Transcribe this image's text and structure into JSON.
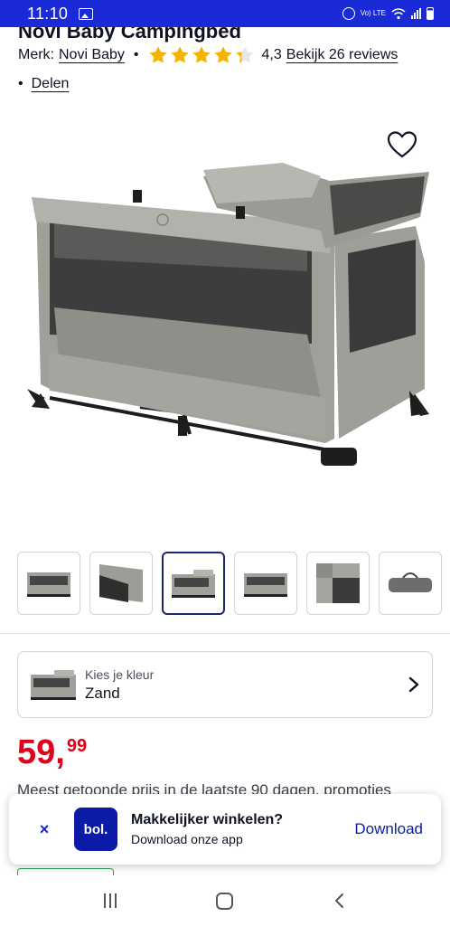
{
  "status_bar": {
    "time": "11:10",
    "network_label": "Vo) LTE",
    "icons": [
      "gallery-icon",
      "alarm-icon",
      "wifi-icon",
      "signal-icon",
      "battery-icon"
    ]
  },
  "product": {
    "title_cropped": "Novi Baby Campingbed",
    "brand_label": "Merk:",
    "brand_name": "Novi Baby",
    "rating": 4.3,
    "rating_text": "4,3",
    "rating_max": 5,
    "reviews_link": "Bekijk 26 reviews",
    "share_link": "Delen"
  },
  "gallery": {
    "thumbnail_count": 6,
    "selected_index": 2
  },
  "color_picker": {
    "caption": "Kies je kleur",
    "value": "Zand"
  },
  "price": {
    "main": "59,",
    "cents": "99",
    "note": "Meest getoonde prijs in de laatste 90 dagen, promoties"
  },
  "app_banner": {
    "close_label": "×",
    "logo_text": "bol.",
    "title": "Makkelijker winkelen?",
    "subtitle": "Download onze app",
    "download_label": "Download"
  },
  "colors": {
    "brand_blue": "#0c1aa8",
    "status_blue": "#1a2ad6",
    "price_red": "#e0001b",
    "star_yellow": "#f5b301"
  }
}
